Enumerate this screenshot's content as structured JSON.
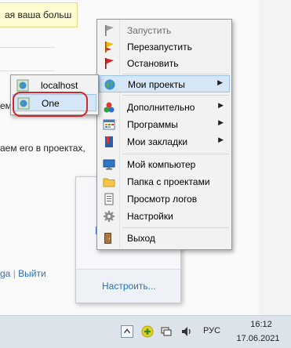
{
  "background": {
    "notice_text": "ая ваша больш",
    "line_1": "ем",
    "line_2": "аем его в проектах, ",
    "links": {
      "first": "ga",
      "separator": "|",
      "second": "Выйти"
    }
  },
  "tray_flyout": {
    "customize_label": "Настроить..."
  },
  "context_menu": {
    "items": [
      {
        "label": "Запустить",
        "icon": "flag-gray-icon",
        "disabled": true
      },
      {
        "label": "Перезапустить",
        "icon": "flag-yellow-icon"
      },
      {
        "label": "Остановить",
        "icon": "flag-red-icon"
      },
      {
        "label": "Мои проекты",
        "icon": "globe-icon",
        "submenu": true,
        "highlighted": true
      },
      {
        "label": "Дополнительно",
        "icon": "shapes-icon",
        "submenu": true
      },
      {
        "label": "Программы",
        "icon": "grid-window-icon",
        "submenu": true
      },
      {
        "label": "Мои закладки",
        "icon": "bookmark-book-icon",
        "submenu": true
      },
      {
        "label": "Мой компьютер",
        "icon": "computer-icon"
      },
      {
        "label": "Папка с проектами",
        "icon": "folder-icon"
      },
      {
        "label": "Просмотр логов",
        "icon": "log-document-icon"
      },
      {
        "label": "Настройки",
        "icon": "gear-icon"
      },
      {
        "label": "Выход",
        "icon": "exit-icon"
      }
    ],
    "submenu_arrow": "▶"
  },
  "projects_submenu": {
    "items": [
      {
        "label": "localhost",
        "icon": "site-globe-icon"
      },
      {
        "label": "One",
        "icon": "site-globe-icon",
        "highlighted": true,
        "circled": true
      }
    ]
  },
  "taskbar": {
    "language": "РУС",
    "time": "16:12",
    "date": "17.06.2021"
  },
  "colors": {
    "highlight_bg": "#d5e6f7",
    "highlight_border": "#9dc3e6",
    "annotation_ring": "#d2262b",
    "link": "#2a6fb8"
  }
}
